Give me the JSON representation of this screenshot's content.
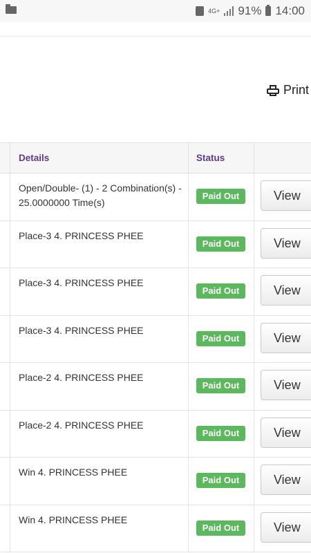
{
  "status_bar": {
    "network": "4G+",
    "battery": "91%",
    "time": "14:00"
  },
  "toolbar": {
    "print_label": "Print"
  },
  "table": {
    "headers": {
      "details": "Details",
      "status": "Status"
    },
    "rows": [
      {
        "details": "Open/Double- (1) - 2 Combination(s) - 25.0000000 Time(s)",
        "status": "Paid Out",
        "action": "View"
      },
      {
        "details": "Place-3 4. PRINCESS PHEE",
        "status": "Paid Out",
        "action": "View"
      },
      {
        "details": "Place-3 4. PRINCESS PHEE",
        "status": "Paid Out",
        "action": "View"
      },
      {
        "details": "Place-3 4. PRINCESS PHEE",
        "status": "Paid Out",
        "action": "View"
      },
      {
        "details": "Place-2 4. PRINCESS PHEE",
        "status": "Paid Out",
        "action": "View"
      },
      {
        "details": "Place-2 4. PRINCESS PHEE",
        "status": "Paid Out",
        "action": "View"
      },
      {
        "details": "Win 4. PRINCESS PHEE",
        "status": "Paid Out",
        "action": "View"
      },
      {
        "details": "Win 4. PRINCESS PHEE",
        "status": "Paid Out",
        "action": "View"
      }
    ]
  },
  "colors": {
    "header_text": "#5c3a8f",
    "badge": "#5cb85c"
  }
}
